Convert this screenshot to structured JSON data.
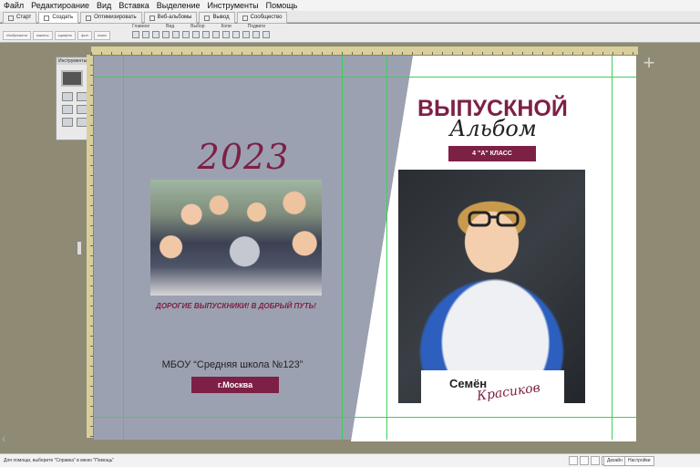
{
  "menu": [
    "Файл",
    "Редактироание",
    "Вид",
    "Вставка",
    "Выделение",
    "Инструменты",
    "Помощь"
  ],
  "tabs": [
    {
      "label": "Старт",
      "active": false
    },
    {
      "label": "Создать",
      "active": true
    },
    {
      "label": "Оптимизировать",
      "active": false
    },
    {
      "label": "Веб-альбомы",
      "active": false
    },
    {
      "label": "Вывод",
      "active": false
    },
    {
      "label": "Сообщество",
      "active": false
    }
  ],
  "toolbar": {
    "group_labels": [
      "Главное",
      "Вид",
      "Выбор",
      "Копи",
      "Подвиги"
    ],
    "left_buttons": [
      "Изобрежени",
      "макеты",
      "шрифты",
      "фон",
      "эскиз"
    ]
  },
  "palette": {
    "title": "Инструменты"
  },
  "spread": {
    "year": "2023",
    "slogan": "ДОРОГИЕ ВЫПУСКНИКИ! В ДОБРЫЙ ПУТЬ!",
    "school": "МБОУ “Средняя школа №123”",
    "city": "г.Москва",
    "title_line1": "ВЫПУСКНОЙ",
    "title_line2": "Альбом",
    "class_label": "4 \"А\" КЛАСС",
    "first_name": "Семён",
    "last_name": "Красиков",
    "accent_color": "#7d2046"
  },
  "statusbar": {
    "message": "Для помощи, выберите \"Справка\" в меню \"Помощь\"",
    "btn_right1": "Дизайн",
    "btn_right2": "Настройки"
  }
}
